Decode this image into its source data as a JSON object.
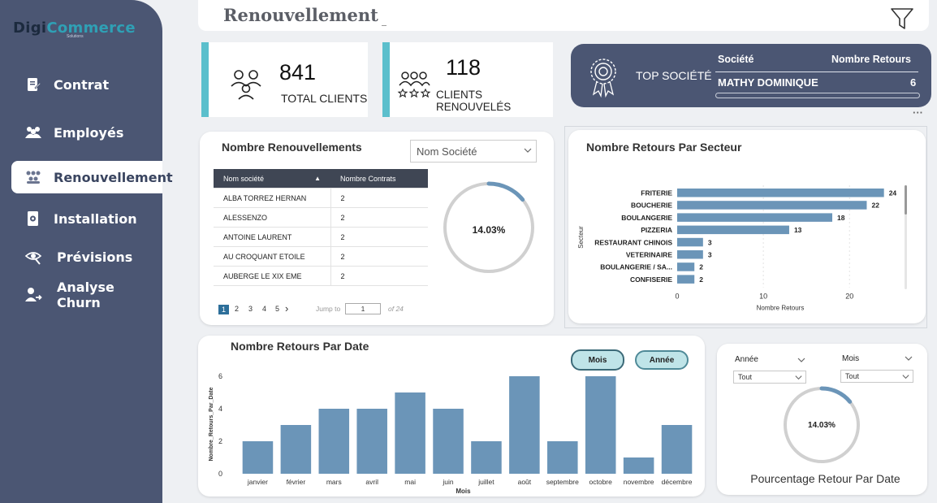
{
  "sidebar": {
    "logo_part1": "Digi",
    "logo_part2": "Commerce",
    "logo_sub": "Solutions",
    "items": [
      {
        "label": "Contrat",
        "icon": "contract-icon"
      },
      {
        "label": "Employés",
        "icon": "people-icon"
      },
      {
        "label": "Renouvellement",
        "icon": "group-icon"
      },
      {
        "label": "Installation",
        "icon": "install-icon"
      },
      {
        "label": "Prévisions",
        "icon": "forecast-icon"
      },
      {
        "label": "Analyse Churn",
        "icon": "user-exit-icon"
      }
    ],
    "active_index": 2
  },
  "header": {
    "title": "Renouvellement",
    "filter_icon": "filter-icon"
  },
  "kpis": [
    {
      "value": "841",
      "label": "TOTAL CLIENTS",
      "icon": "two-users-icon"
    },
    {
      "value": "118",
      "label": "CLIENTS RENOUVELÉS",
      "icon": "rated-users-icon"
    }
  ],
  "top_societe": {
    "label": "TOP SOCIÉTÉ",
    "col1": "Société",
    "col2": "Nombre Retours",
    "name": "MATHY DOMINIQUE",
    "count": "6",
    "icon": "award-icon"
  },
  "more_options": "···",
  "renouvellements": {
    "title": "Nombre Renouvellements",
    "dropdown_placeholder": "Nom Société",
    "columns": [
      "Nom société",
      "Nombre Contrats"
    ],
    "rows": [
      [
        "ALBA TORREZ HERNAN",
        "2"
      ],
      [
        "ALESSENZO",
        "2"
      ],
      [
        "ANTOINE LAURENT",
        "2"
      ],
      [
        "AU CROQUANT ETOILE",
        "2"
      ],
      [
        "AUBERGE LE XIX EME",
        "2"
      ]
    ],
    "pages": [
      "1",
      "2",
      "3",
      "4",
      "5"
    ],
    "next": "›",
    "jump_label": "Jump to",
    "jump_value": "1",
    "of_total": "of 24",
    "gauge_label": "14.03%",
    "gauge_value": 0.1403,
    "colors": {
      "gauge_track": "#d0d0d0",
      "gauge_fill": "#6b95b8"
    }
  },
  "secteur_chart": {
    "title": "Nombre Retours Par Secteur",
    "chart_data": {
      "type": "bar",
      "orientation": "horizontal",
      "categories": [
        "FRITERIE",
        "BOUCHERIE",
        "BOULANGERIE",
        "PIZZERIA",
        "RESTAURANT CHINOIS",
        "VETERINAIRE",
        "BOULANGERIE / SA...",
        "CONFISERIE"
      ],
      "values": [
        24,
        22,
        18,
        13,
        3,
        3,
        2,
        2
      ],
      "xlabel": "Nombre Retours",
      "ylabel": "Secteur",
      "xticks": [
        "0",
        "10",
        "20"
      ],
      "xlim": [
        0,
        24.5
      ],
      "color": "#6b95b8"
    }
  },
  "date_chart": {
    "title": "Nombre Retours Par Date",
    "toggle_mois": "Mois",
    "toggle_annee": "Année",
    "chart_data": {
      "type": "bar",
      "categories": [
        "janvier",
        "février",
        "mars",
        "avril",
        "mai",
        "juin",
        "juillet",
        "août",
        "septembre",
        "octobre",
        "novembre",
        "décembre"
      ],
      "values": [
        2,
        3,
        4,
        4,
        5,
        4,
        2,
        6,
        2,
        6,
        1,
        3
      ],
      "xlabel": "Mois",
      "ylabel": "Nombre_Retours_Par_Date",
      "yticks": [
        "0",
        "2",
        "4",
        "6"
      ],
      "ylim": [
        0,
        6
      ],
      "color": "#6b95b8"
    }
  },
  "pct_card": {
    "annee_label": "Année",
    "annee_value": "Tout",
    "mois_label": "Mois",
    "mois_value": "Tout",
    "gauge_label": "14.03%",
    "gauge_value": 0.1403,
    "caption": "Pourcentage Retour Par Date"
  }
}
